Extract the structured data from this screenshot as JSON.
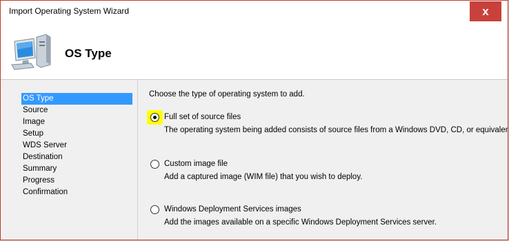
{
  "window": {
    "title": "Import Operating System Wizard",
    "close_glyph": "x"
  },
  "header": {
    "title": "OS Type",
    "icon": "computer-icon"
  },
  "sidebar": {
    "items": [
      {
        "label": "OS Type",
        "active": true
      },
      {
        "label": "Source"
      },
      {
        "label": "Image"
      },
      {
        "label": "Setup"
      },
      {
        "label": "WDS Server"
      },
      {
        "label": "Destination"
      },
      {
        "label": "Summary"
      },
      {
        "label": "Progress"
      },
      {
        "label": "Confirmation"
      }
    ]
  },
  "main": {
    "prompt": "Choose the type of operating system to add.",
    "options": [
      {
        "label": "Full set of source files",
        "description": "The operating system being added consists of source files from a Windows DVD, CD, or equivalent.",
        "selected": true
      },
      {
        "label": "Custom image file",
        "description": "Add a captured image (WIM file) that you wish to deploy.",
        "selected": false
      },
      {
        "label": "Windows Deployment Services images",
        "description": "Add the images available on a specific Windows Deployment Services server.",
        "selected": false
      }
    ]
  },
  "colors": {
    "selection": "#3399ff",
    "close": "#c9413b",
    "highlight": "#ffff00"
  }
}
